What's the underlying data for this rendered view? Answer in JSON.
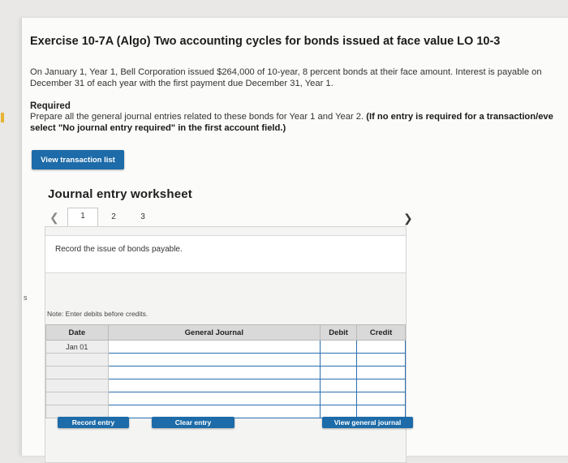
{
  "exercise": {
    "title": "Exercise 10-7A (Algo) Two accounting cycles for bonds issued at face value LO 10-3",
    "description_line1": "On January 1, Year 1, Bell Corporation issued $264,000 of 10-year, 8 percent bonds at their face amount. Interest is payable on",
    "description_line2": "December 31 of each year with the first payment due December 31, Year 1.",
    "required_label": "Required",
    "instruction_line1_plain": "Prepare all the general journal entries related to these bonds for Year 1 and Year 2. ",
    "instruction_line1_bold": "(If no entry is required for a transaction/eve",
    "instruction_line2_bold": "select \"No journal entry required\" in the first account field.)"
  },
  "margin_mark": "s",
  "buttons": {
    "view_transaction_list": "View transaction list",
    "record_entry": "Record entry",
    "clear_entry": "Clear entry",
    "view_general_journal": "View general journal"
  },
  "worksheet": {
    "title": "Journal entry worksheet",
    "tabs": [
      "1",
      "2",
      "3"
    ],
    "active_tab": "1",
    "prev_icon": "chevron-left-icon",
    "next_icon": "chevron-right-icon",
    "record_prompt": "Record the issue of bonds payable.",
    "note": "Note: Enter debits before credits.",
    "table": {
      "headers": [
        "Date",
        "General Journal",
        "Debit",
        "Credit"
      ],
      "rows": [
        {
          "date": "Jan 01",
          "account": "",
          "debit": "",
          "credit": ""
        },
        {
          "date": "",
          "account": "",
          "debit": "",
          "credit": ""
        },
        {
          "date": "",
          "account": "",
          "debit": "",
          "credit": ""
        },
        {
          "date": "",
          "account": "",
          "debit": "",
          "credit": ""
        },
        {
          "date": "",
          "account": "",
          "debit": "",
          "credit": ""
        },
        {
          "date": "",
          "account": "",
          "debit": "",
          "credit": ""
        }
      ]
    }
  },
  "colors": {
    "button_blue": "#1d6ba8",
    "input_border_blue": "#2a6fb0",
    "required_tab_gold": "#e7b431"
  }
}
